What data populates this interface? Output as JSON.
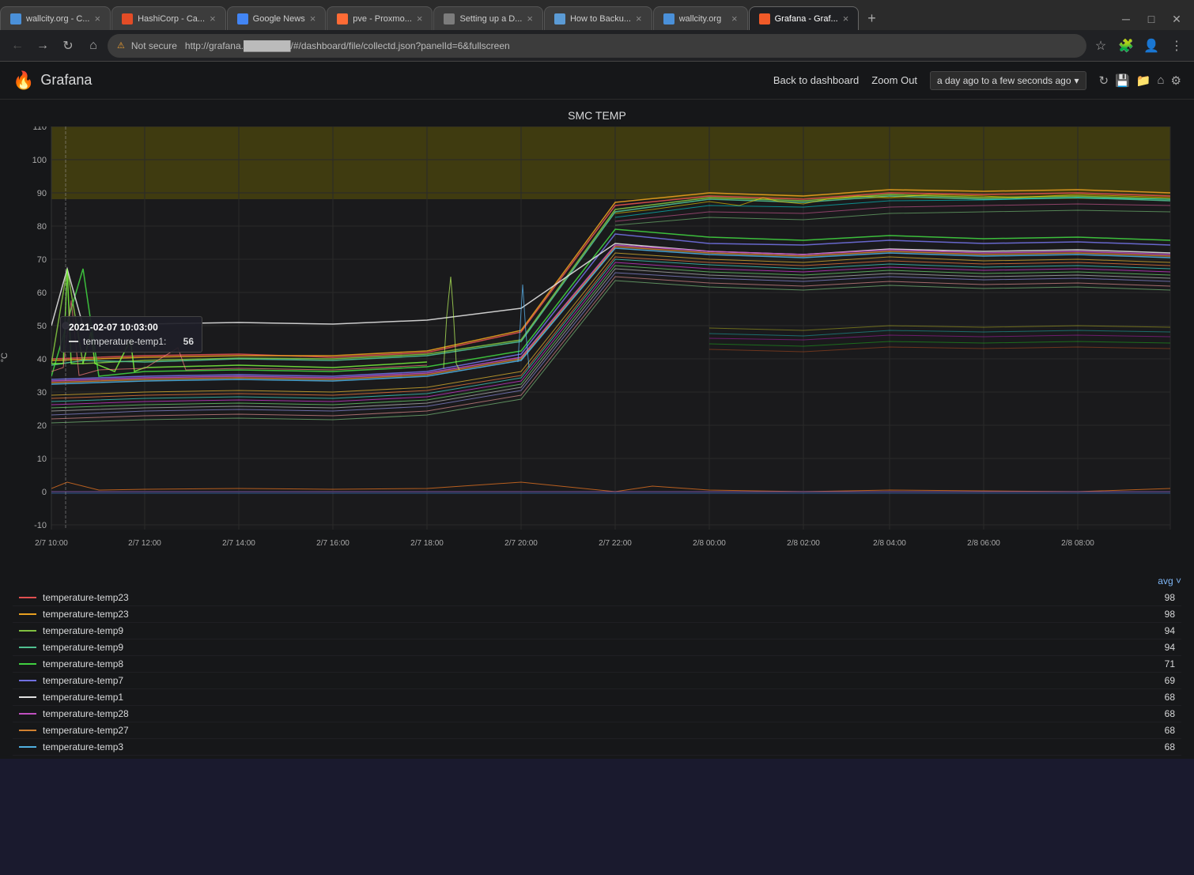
{
  "browser": {
    "tabs": [
      {
        "id": "tab1",
        "favicon_color": "#4a90d9",
        "title": "wallcity.org - C...",
        "active": false
      },
      {
        "id": "tab2",
        "favicon_color": "#e34c26",
        "title": "HashiCorp - Ca...",
        "active": false
      },
      {
        "id": "tab3",
        "favicon_color": "#4285f4",
        "title": "Google News",
        "active": false
      },
      {
        "id": "tab4",
        "favicon_color": "#ff6b35",
        "title": "pve - Proxmo...",
        "active": false
      },
      {
        "id": "tab5",
        "favicon_color": "#7c7c7c",
        "title": "Setting up a D...",
        "active": false
      },
      {
        "id": "tab6",
        "favicon_color": "#5b9bd5",
        "title": "How to Backu...",
        "active": false
      },
      {
        "id": "tab7",
        "favicon_color": "#4a90d9",
        "title": "wallcity.org",
        "active": false
      },
      {
        "id": "tab8",
        "favicon_color": "#f05a28",
        "title": "Grafana - Graf...",
        "active": true
      }
    ],
    "url_prefix": "Not secure",
    "url": "http://grafana.███████/#/dashboard/file/collectd.json?panelId=6&fullscreen",
    "url_display": "http://grafana.███████/#/dashboard/file/collectd.json?panelId=6&fullscreen"
  },
  "grafana": {
    "app_name": "Grafana",
    "header": {
      "back_button": "Back to dashboard",
      "zoom_out": "Zoom Out",
      "time_range": "a day ago to a few seconds ago",
      "time_range_suffix": "˅"
    },
    "chart": {
      "title": "SMC TEMP",
      "y_axis_unit": "°C",
      "y_labels": [
        110,
        100,
        90,
        80,
        70,
        60,
        50,
        40,
        30,
        20,
        10,
        0,
        -10
      ],
      "x_labels": [
        "2/7 10:00",
        "2/7 12:00",
        "2/7 14:00",
        "2/7 16:00",
        "2/7 18:00",
        "2/7 20:00",
        "2/7 22:00",
        "2/8 00:00",
        "2/8 02:00",
        "2/8 04:00",
        "2/8 06:00",
        "2/8 08:00"
      ],
      "tooltip": {
        "time": "2021-02-07 10:03:00",
        "series_label": "temperature-temp1:",
        "series_value": "56"
      }
    },
    "legend": {
      "sort_label": "avg ˅",
      "items": [
        {
          "name": "temperature-temp23",
          "color": "#e05050",
          "value": "98"
        },
        {
          "name": "temperature-temp23",
          "color": "#e8a020",
          "value": "98"
        },
        {
          "name": "temperature-temp9",
          "color": "#a0c060",
          "value": "94"
        },
        {
          "name": "temperature-temp9",
          "color": "#60c0a0",
          "value": "94"
        },
        {
          "name": "temperature-temp8",
          "color": "#50d050",
          "value": "71"
        },
        {
          "name": "temperature-temp7",
          "color": "#7070e0",
          "value": "69"
        },
        {
          "name": "temperature-temp1",
          "color": "#e0e0e0",
          "value": "68"
        },
        {
          "name": "temperature-temp28",
          "color": "#c050c0",
          "value": "68"
        },
        {
          "name": "temperature-temp27",
          "color": "#d08030",
          "value": "68"
        },
        {
          "name": "temperature-temp3",
          "color": "#50b0e0",
          "value": "68"
        }
      ]
    }
  }
}
